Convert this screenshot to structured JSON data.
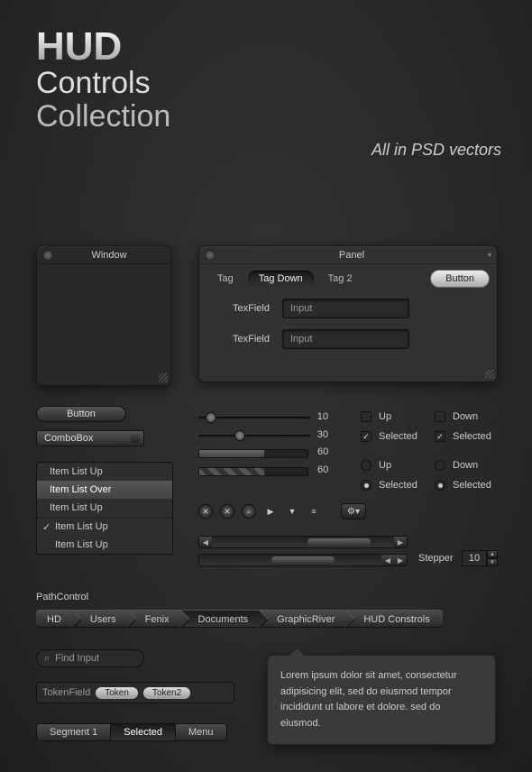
{
  "hero": {
    "line1": "HUD",
    "line2": "Controls",
    "line3": "Collection",
    "tagline": "All in PSD vectors"
  },
  "window": {
    "title": "Window"
  },
  "panel": {
    "title": "Panel",
    "tags": [
      "Tag",
      "Tag Down",
      "Tag 2"
    ],
    "button": "Button",
    "fields": [
      {
        "label": "TexField",
        "value": "Input"
      },
      {
        "label": "TexField",
        "value": "Input"
      }
    ]
  },
  "button": {
    "label": "Button"
  },
  "combo": {
    "label": "ComboBox"
  },
  "list": {
    "items": [
      "Item List Up",
      "Item List Over",
      "Item List Up",
      "Item List Up",
      "Item List Up"
    ]
  },
  "sliders": [
    {
      "value": 10
    },
    {
      "value": 30
    }
  ],
  "progress": [
    {
      "label": "60"
    },
    {
      "label": "60"
    }
  ],
  "checks": {
    "up": "Up",
    "down": "Down",
    "selected": "Selected"
  },
  "stepper": {
    "label": "Stepper",
    "value": "10"
  },
  "pathcontrol": {
    "label": "PathControl",
    "items": [
      "HD",
      "Users",
      "Fenix",
      "Documents",
      "GraphicRiver",
      "HUD Constrols"
    ]
  },
  "find": {
    "placeholder": "Find Input"
  },
  "tokenfield": {
    "label": "TokenField",
    "tokens": [
      "Token",
      "Token2"
    ]
  },
  "segments": [
    "Segment 1",
    "Selected",
    "Menu"
  ],
  "tooltip": "Lorem ipsum dolor sit amet, consectetur adipisicing elit, sed do eiusmod tempor incididunt ut labore et dolore. sed do eiusmod."
}
